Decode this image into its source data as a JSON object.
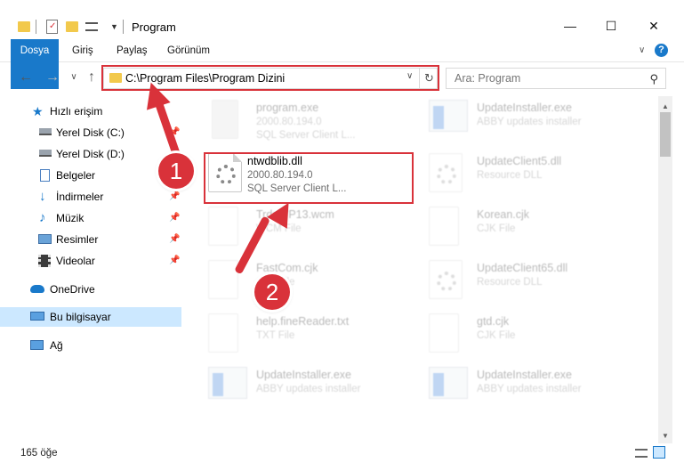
{
  "window": {
    "title": "Program",
    "minimize_glyph": "—",
    "maximize_glyph": "☐",
    "close_glyph": "✕"
  },
  "ribbon": {
    "tabs": [
      "Dosya",
      "Giriş",
      "Paylaş",
      "Görünüm"
    ],
    "help_glyph": "?",
    "collapse_glyph": "∨"
  },
  "address_bar": {
    "path": "C:\\Program Files\\Program Dizini",
    "dropdown_glyph": "∨",
    "refresh_glyph": "↻"
  },
  "nav_buttons": {
    "back": "←",
    "forward": "→",
    "recent": "∨",
    "up": "↑"
  },
  "search": {
    "placeholder": "Ara: Program",
    "icon_glyph": "⚲"
  },
  "nav_pane": {
    "items": [
      {
        "label": "Hızlı erişim",
        "icon": "star-icon"
      },
      {
        "label": "Yerel Disk (C:)",
        "icon": "drive-icon",
        "pinned": true
      },
      {
        "label": "Yerel Disk (D:)",
        "icon": "drive-icon",
        "pinned": true
      },
      {
        "label": "Belgeler",
        "icon": "documents-icon",
        "pinned": true
      },
      {
        "label": "İndirmeler",
        "icon": "downloads-icon",
        "pinned": true
      },
      {
        "label": "Müzik",
        "icon": "music-icon",
        "pinned": true
      },
      {
        "label": "Resimler",
        "icon": "pictures-icon",
        "pinned": true
      },
      {
        "label": "Videolar",
        "icon": "videos-icon",
        "pinned": true
      },
      {
        "label": "OneDrive",
        "icon": "cloud-icon"
      },
      {
        "label": "Bu bilgisayar",
        "icon": "computer-icon",
        "selected": true
      },
      {
        "label": "Ağ",
        "icon": "network-icon"
      }
    ],
    "pin_glyph": "📌"
  },
  "files": [
    {
      "name": "program.exe",
      "line1": "2000.80.194.0",
      "line2": "SQL Server Client L...",
      "kind": "exe",
      "faded": true
    },
    {
      "name": "UpdateInstaller.exe",
      "line1": "ABBY updates installer",
      "line2": "",
      "kind": "installer",
      "faded": true
    },
    {
      "name": "ntwdblib.dll",
      "line1": "2000.80.194.0",
      "line2": "SQL Server Client L...",
      "kind": "dll",
      "faded": false
    },
    {
      "name": "UpdateClient5.dll",
      "line1": "Resource DLL",
      "line2": "",
      "kind": "dll",
      "faded": true
    },
    {
      "name": "TrdsWP13.wcm",
      "line1": "WCM File",
      "line2": "",
      "kind": "doc",
      "faded": true
    },
    {
      "name": "Korean.cjk",
      "line1": "CJK File",
      "line2": "",
      "kind": "doc",
      "faded": true
    },
    {
      "name": "FastCom.cjk",
      "line1": "CJK File",
      "line2": "",
      "kind": "doc",
      "faded": true
    },
    {
      "name": "UpdateClient65.dll",
      "line1": "Resource DLL",
      "line2": "",
      "kind": "dll",
      "faded": true
    },
    {
      "name": "help.fineReader.txt",
      "line1": "TXT File",
      "line2": "",
      "kind": "doc",
      "faded": true
    },
    {
      "name": "gtd.cjk",
      "line1": "CJK File",
      "line2": "",
      "kind": "doc",
      "faded": true
    },
    {
      "name": "UpdateInstaller.exe",
      "line1": "ABBY updates installer",
      "line2": "",
      "kind": "installer",
      "faded": true
    },
    {
      "name": "UpdateInstaller.exe",
      "line1": "ABBY updates installer",
      "line2": "",
      "kind": "installer",
      "faded": true
    }
  ],
  "status_bar": {
    "item_count": "165 öğe"
  },
  "callouts": [
    "1",
    "2"
  ],
  "colors": {
    "accent": "#1979ca",
    "highlight": "#d9323a",
    "selected_nav": "#cce8ff"
  }
}
